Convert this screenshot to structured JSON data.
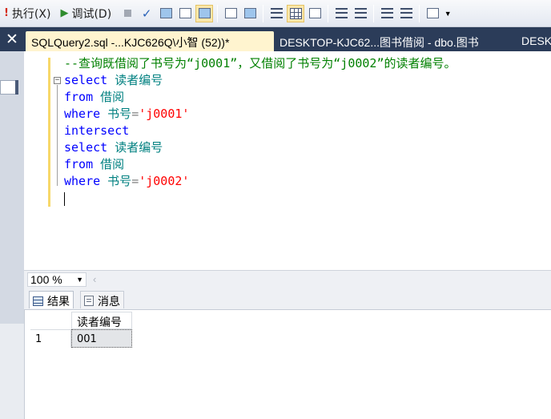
{
  "toolbar": {
    "execute_label": "执行(X)",
    "debug_label": "调试(D)"
  },
  "tabs": {
    "active": "SQLQuery2.sql -...KJC626Q\\小智 (52))*",
    "second": "DESKTOP-KJC62...图书借阅 - dbo.图书",
    "third": "DESK"
  },
  "editor": {
    "lines": [
      {
        "comment": "--查询既借阅了书号为“j0001”，又借阅了书号为“j0002”的读者编号。"
      },
      {
        "kw": "select",
        "rest": " 读者编号"
      },
      {
        "kw": "from",
        "rest": " 借阅"
      },
      {
        "kw": "where",
        "ident": " 书号",
        "op": "=",
        "str": "'j0001'"
      },
      {
        "kw": "intersect"
      },
      {
        "kw": "select",
        "rest": " 读者编号"
      },
      {
        "kw": "from",
        "rest": " 借阅"
      },
      {
        "kw": "where",
        "ident": " 书号",
        "op": "=",
        "str": "'j0002'"
      }
    ]
  },
  "zoom": {
    "value": "100 %"
  },
  "results": {
    "tab_results": "结果",
    "tab_messages": "消息",
    "columns": [
      "读者编号"
    ],
    "rows": [
      {
        "row_number": "1",
        "values": [
          "001"
        ]
      }
    ]
  }
}
